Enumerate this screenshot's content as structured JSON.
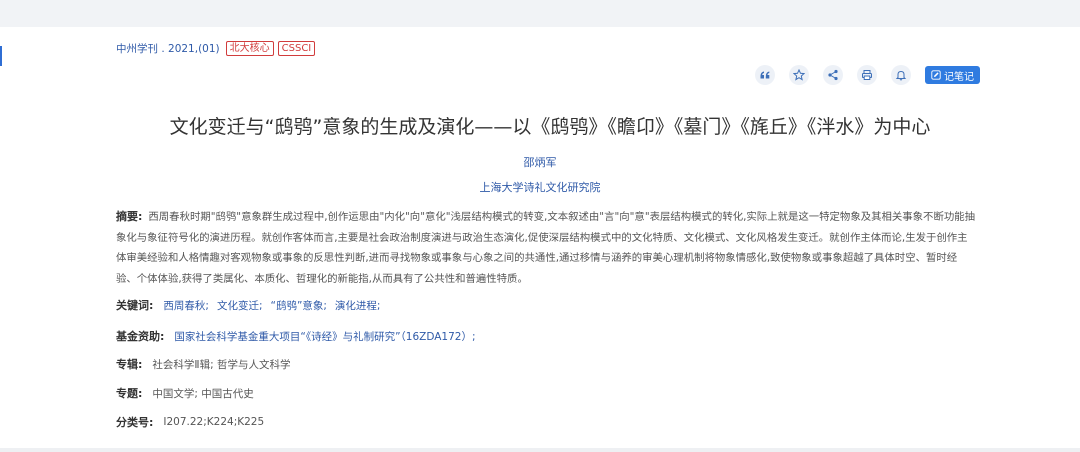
{
  "source": {
    "journal": "中州学刊 . 2021,(01)",
    "badges": [
      "北大核心",
      "CSSCI"
    ]
  },
  "toolbar": {
    "icons": [
      "quote-icon",
      "star-icon",
      "share-icon",
      "print-icon",
      "bell-icon"
    ],
    "note_label": "记笔记",
    "accent": "#2f7be0"
  },
  "article": {
    "title": "文化变迁与“鸱鸮”意象的生成及演化——以《鸱鸮》《瞻卬》《墓门》《旄丘》《泮水》为中心",
    "author": "邵炳军",
    "organization": "上海大学诗礼文化研究院",
    "abstract_label": "摘要:",
    "abstract": "西周春秋时期\"鸱鸮\"意象群生成过程中,创作运思由\"内化\"向\"意化\"浅层结构模式的转变,文本叙述由\"言\"向\"意\"表层结构模式的转化,实际上就是这一特定物象及其相关事象不断功能抽象化与象征符号化的演进历程。就创作客体而言,主要是社会政治制度演进与政治生态演化,促使深层结构模式中的文化特质、文化模式、文化风格发生变迁。就创作主体而论,生发于创作主体审美经验和人格情趣对客观物象或事象的反思性判断,进而寻找物象或事象与心象之间的共通性,通过移情与涵养的审美心理机制将物象情感化,致使物象或事象超越了具体时空、暂时经验、个体体验,获得了类属化、本质化、哲理化的新能指,从而具有了公共性和普遍性特质。",
    "keywords_label": "关键词:",
    "keywords": [
      "西周春秋;",
      "文化变迁;",
      "“鸱鸮”意象;",
      "演化进程;"
    ],
    "fund_label": "基金资助:",
    "fund": "国家社会科学基金重大项目“《诗经》与礼制研究”（16ZDA172）;",
    "series_label": "专辑:",
    "series": "社会科学Ⅱ辑; 哲学与人文科学",
    "topic_label": "专题:",
    "topic": "中国文学; 中国古代史",
    "class_label": "分类号:",
    "class_no": "I207.22;K224;K225"
  }
}
